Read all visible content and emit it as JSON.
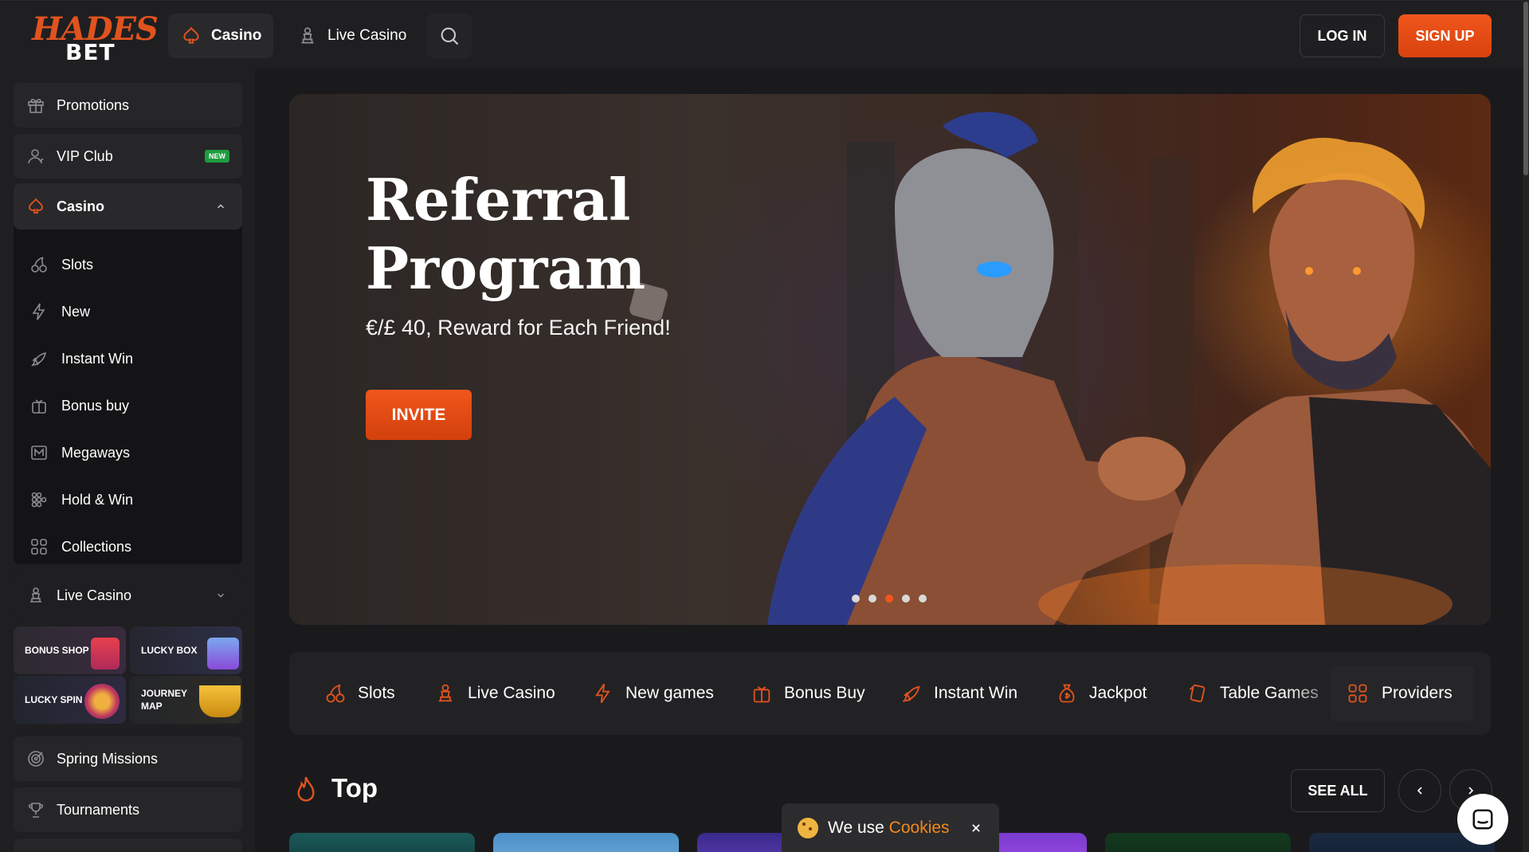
{
  "header": {
    "logo_line1": "HADES",
    "logo_line2": "BET",
    "nav": [
      {
        "label": "Casino",
        "icon": "spade-icon",
        "active": true
      },
      {
        "label": "Live Casino",
        "icon": "dealer-icon",
        "active": false
      }
    ],
    "login_label": "LOG IN",
    "signup_label": "SIGN UP"
  },
  "sidebar": {
    "promotions": "Promotions",
    "vip": {
      "label": "VIP Club",
      "badge": "NEW"
    },
    "casino": {
      "label": "Casino",
      "items": [
        "Slots",
        "New",
        "Instant Win",
        "Bonus buy",
        "Megaways",
        "Hold & Win",
        "Collections"
      ]
    },
    "live_casino": "Live Casino",
    "tiles": [
      {
        "label": "BONUS SHOP"
      },
      {
        "label": "LUCKY BOX"
      },
      {
        "label": "LUCKY SPIN"
      },
      {
        "label": "JOURNEY MAP"
      }
    ],
    "spring_missions": "Spring Missions",
    "tournaments": "Tournaments"
  },
  "hero": {
    "title": "Referral\nProgram",
    "subtitle": "€/£ 40, Reward for Each Friend!",
    "cta": "INVITE",
    "slides_total": 5,
    "active_slide": 3
  },
  "categories": [
    {
      "label": "Slots",
      "icon": "cherries-icon"
    },
    {
      "label": "Live Casino",
      "icon": "dealer-icon"
    },
    {
      "label": "New games",
      "icon": "lightning-icon"
    },
    {
      "label": "Bonus Buy",
      "icon": "gift-icon"
    },
    {
      "label": "Instant Win",
      "icon": "rocket-icon"
    },
    {
      "label": "Jackpot",
      "icon": "money-bag-icon"
    },
    {
      "label": "Table Games",
      "icon": "cards-icon"
    }
  ],
  "providers_label": "Providers",
  "top_section": {
    "title": "Top",
    "see_all": "SEE ALL"
  },
  "cookie": {
    "text": "We use",
    "link": "Cookies"
  },
  "colors": {
    "accent": "#f0561c",
    "background": "#1a1a1c",
    "panel": "#1f1f21",
    "new_badge": "#1e9c3e"
  }
}
